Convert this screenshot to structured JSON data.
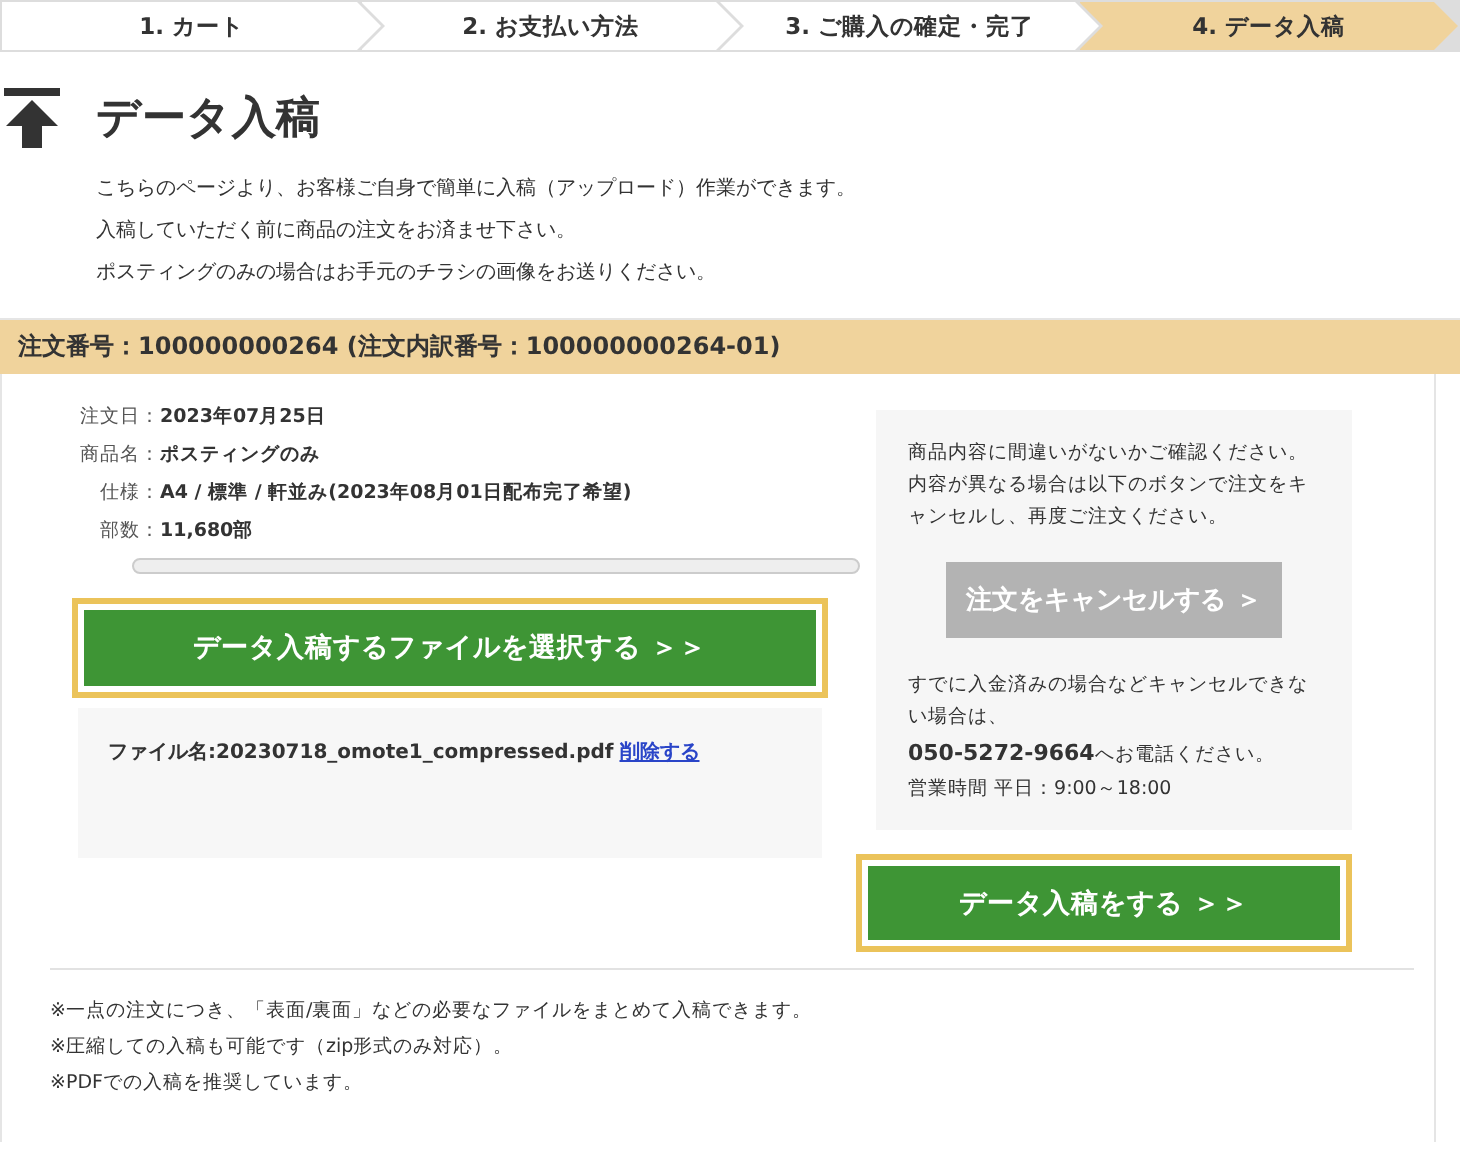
{
  "steps": [
    {
      "label": "1. カート",
      "selected": false
    },
    {
      "label": "2. お支払い方法",
      "selected": false
    },
    {
      "label": "3. ご購入の確定・完了",
      "selected": false
    },
    {
      "label": "4. データ入稿",
      "selected": true
    }
  ],
  "page_title": "データ入稿",
  "intro": [
    "こちらのページより、お客様ご自身で簡単に入稿（アップロード）作業ができます。",
    "入稿していただく前に商品の注文をお済ませ下さい。",
    "ポスティングのみの場合はお手元のチラシの画像をお送りください。"
  ],
  "order_header": "注文番号：100000000264 (注文内訳番号：100000000264-01)",
  "order_details": [
    {
      "label": "注文日：",
      "value": "2023年07月25日"
    },
    {
      "label": "商品名：",
      "value": "ポスティングのみ"
    },
    {
      "label": "仕様：",
      "value": "A4 / 標準 / 軒並み(2023年08月01日配布完了希望)"
    },
    {
      "label": "部数：",
      "value": "11,680部"
    }
  ],
  "select_file_button": "データ入稿するファイルを選択する ＞＞",
  "file": {
    "name": "ファイル名:20230718_omote1_compressed.pdf",
    "delete_link": "削除する"
  },
  "side_panel": {
    "notice": "商品内容に間違いがないかご確認ください。内容が異なる場合は以下のボタンで注文をキャンセルし、再度ご注文ください。",
    "cancel_button": "注文をキャンセルする ＞",
    "cancel_note": "すでに入金済みの場合などキャンセルできない場合は、",
    "phone": "050-5272-9664",
    "phone_suffix": "へお電話ください。",
    "hours": "営業時間 平日：9:00～18:00"
  },
  "submit_button": "データ入稿をする ＞＞",
  "notes": [
    "※一点の注文につき、「表面/裏面」などの必要なファイルをまとめて入稿できます。",
    "※圧縮しての入稿も可能です（zip形式のみ対応）。",
    "※PDFでの入稿を推奨しています。"
  ]
}
